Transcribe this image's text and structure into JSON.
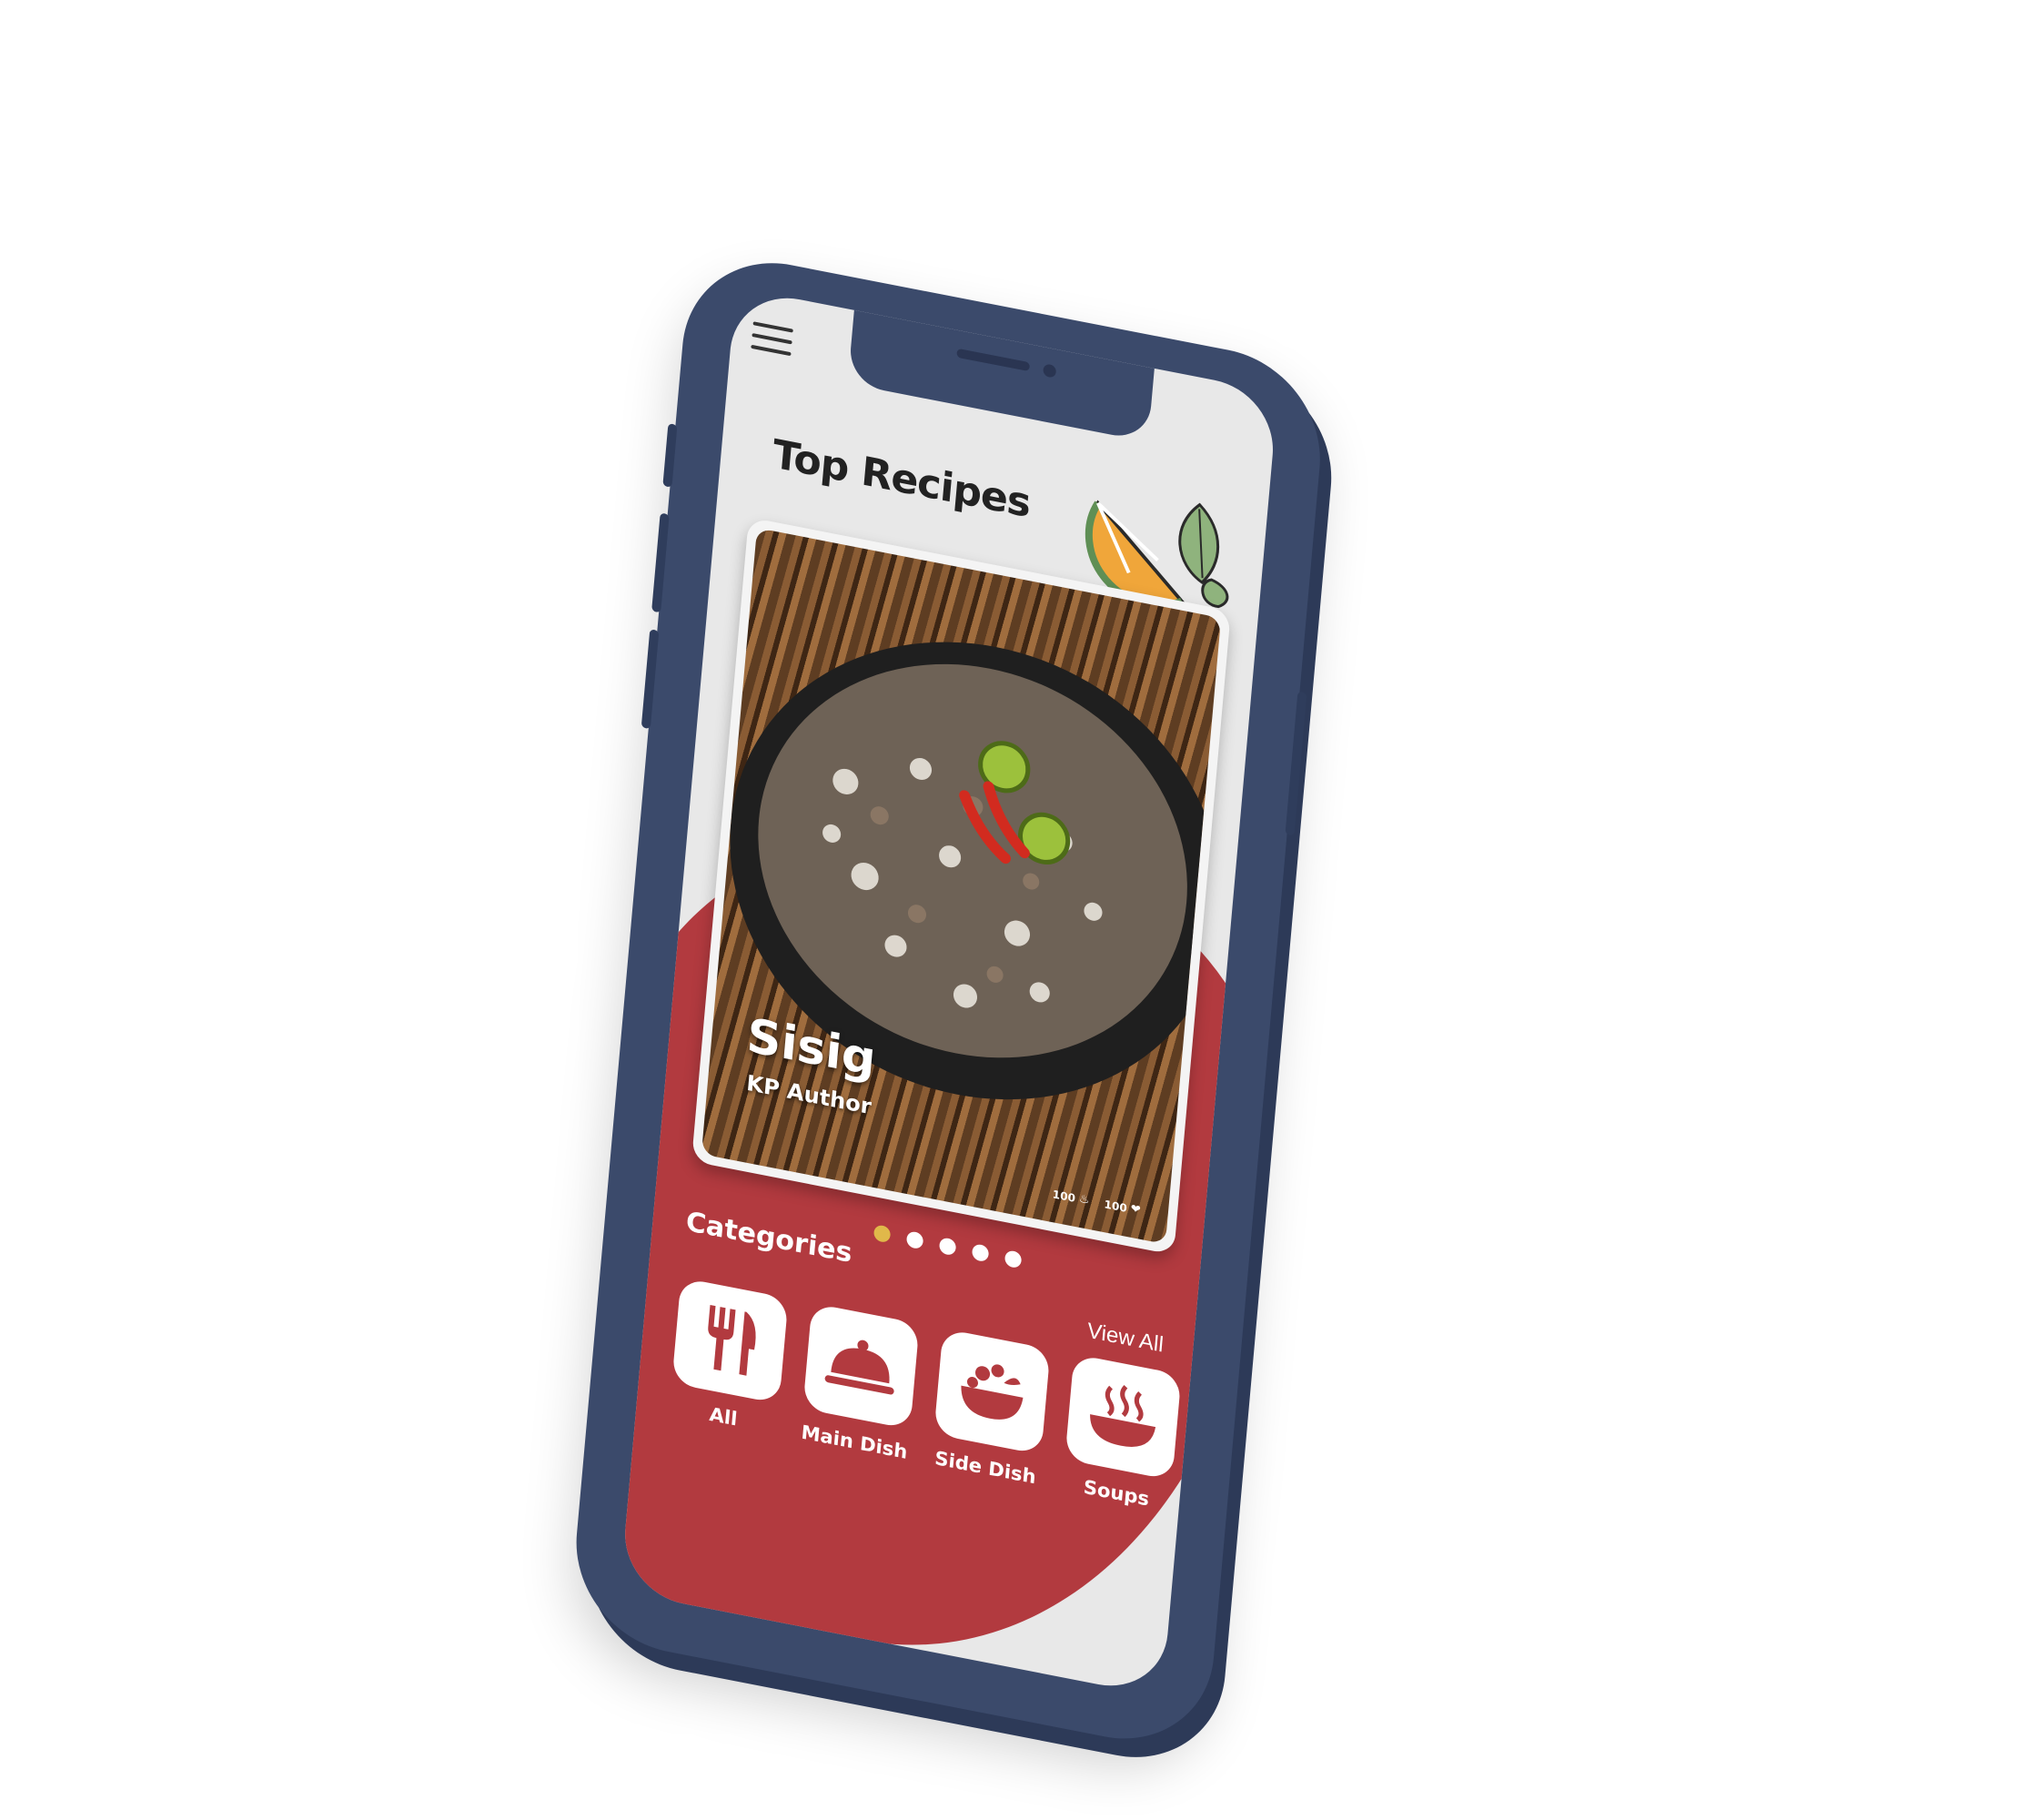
{
  "header": {
    "title": "Top Recipes"
  },
  "featured": {
    "name": "Sisig",
    "author": "KP Author",
    "cooks": "100",
    "likes": "100"
  },
  "carousel": {
    "total": 5,
    "active": 1
  },
  "categories": {
    "title": "Categories",
    "view_all": "View All",
    "items": [
      {
        "label": "All",
        "icon": "utensils-icon"
      },
      {
        "label": "Main Dish",
        "icon": "cloche-icon"
      },
      {
        "label": "Side Dish",
        "icon": "salad-bowl-icon"
      },
      {
        "label": "Soups",
        "icon": "soup-bowl-icon"
      }
    ]
  },
  "colors": {
    "phone_frame": "#3b4a6b",
    "accent_red": "#b23a3f",
    "screen_bg": "#e8e8e8",
    "dot_active": "#e0b84a",
    "logo_orange": "#f0a63a",
    "logo_green": "#5f8f55"
  }
}
